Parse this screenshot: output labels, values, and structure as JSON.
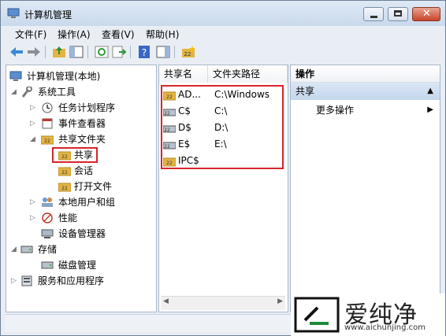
{
  "window": {
    "title": "计算机管理"
  },
  "menu": [
    "文件(F)",
    "操作(A)",
    "查看(V)",
    "帮助(H)"
  ],
  "tree": {
    "root": "计算机管理(本地)",
    "system_tools": "系统工具",
    "task_scheduler": "任务计划程序",
    "event_viewer": "事件查看器",
    "shared_folders": "共享文件夹",
    "shares": "共享",
    "sessions": "会话",
    "open_files": "打开文件",
    "local_users": "本地用户和组",
    "performance": "性能",
    "device_manager": "设备管理器",
    "storage": "存储",
    "disk_management": "磁盘管理",
    "services_apps": "服务和应用程序"
  },
  "list": {
    "columns": [
      "共享名",
      "文件夹路径"
    ],
    "rows": [
      {
        "name": "AD...",
        "path": "C:\\Windows"
      },
      {
        "name": "C$",
        "path": "C:\\"
      },
      {
        "name": "D$",
        "path": "D:\\"
      },
      {
        "name": "E$",
        "path": "E:\\"
      },
      {
        "name": "IPC$",
        "path": ""
      }
    ]
  },
  "actions": {
    "title": "操作",
    "section": "共享",
    "more": "更多操作"
  },
  "watermark": {
    "brand": "爱纯净",
    "url": "www.aichunjing.com"
  },
  "colors": {
    "highlight": "#d8242c",
    "folder": "#e2b443"
  }
}
